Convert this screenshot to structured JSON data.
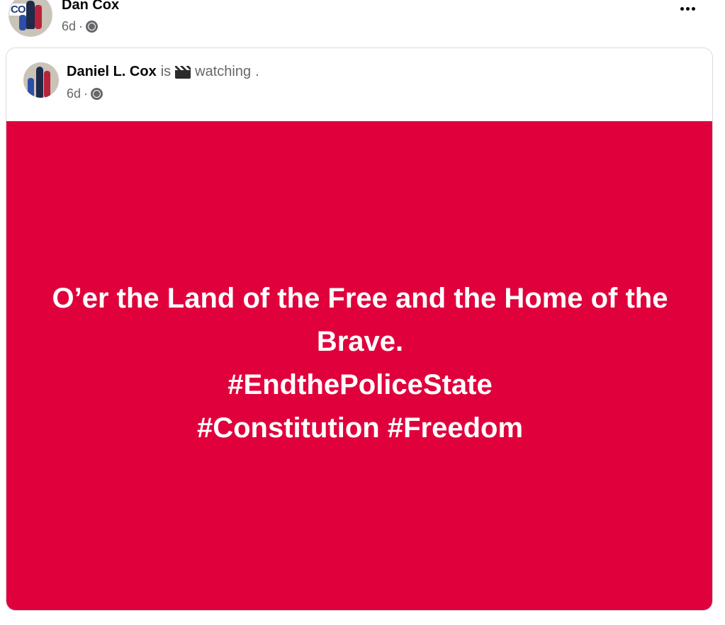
{
  "post": {
    "author": "Dan Cox",
    "time": "6d",
    "separator": "·",
    "privacy_icon": "globe-icon",
    "more_icon": "more-options-icon",
    "avatar_logo_text": "CO"
  },
  "shared_post": {
    "author": "Daniel L. Cox",
    "verb": "is",
    "activity_icon": "clapperboard-icon",
    "activity": "watching",
    "period": ".",
    "time": "6d",
    "separator": "·",
    "privacy_icon": "globe-icon",
    "background_color": "#e0003c",
    "text_lines": [
      "O’er the Land of the Free and the Home of the Brave.",
      "#EndthePoliceState",
      "#Constitution #Freedom"
    ]
  }
}
